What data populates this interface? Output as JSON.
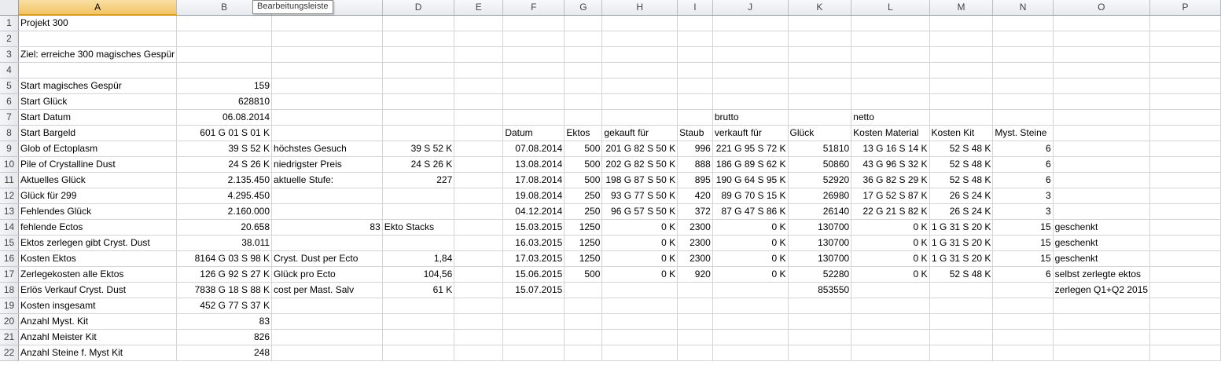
{
  "columns": [
    "A",
    "B",
    "C",
    "D",
    "E",
    "F",
    "G",
    "H",
    "I",
    "J",
    "K",
    "L",
    "M",
    "N",
    "O",
    "P"
  ],
  "tooltip": "Bearbeitungsleiste",
  "rows": [
    {
      "num": "1",
      "cells": {
        "A": "Projekt 300"
      }
    },
    {
      "num": "2",
      "cells": {}
    },
    {
      "num": "3",
      "cells": {
        "A": "Ziel: erreiche 300 magisches Gespür"
      }
    },
    {
      "num": "4",
      "cells": {}
    },
    {
      "num": "5",
      "cells": {
        "A": "Start magisches Gespür",
        "B": "159"
      }
    },
    {
      "num": "6",
      "cells": {
        "A": "Start Glück",
        "B": "628810"
      }
    },
    {
      "num": "7",
      "cells": {
        "A": "Start Datum",
        "B": "06.08.2014",
        "J": "brutto",
        "L": "netto"
      }
    },
    {
      "num": "8",
      "cells": {
        "A": "Start Bargeld",
        "B": "601 G 01 S 01 K",
        "F": "Datum",
        "G": "Ektos",
        "H": "gekauft für",
        "I": "Staub",
        "J": "verkauft für",
        "K": "Glück",
        "L": "Kosten Material",
        "M": "Kosten Kit",
        "N": "Myst. Steine"
      }
    },
    {
      "num": "9",
      "cells": {
        "A": "Glob of Ectoplasm",
        "B": "39 S 52 K",
        "C": "höchstes Gesuch",
        "D": "39 S 52 K",
        "F": "07.08.2014",
        "G": "500",
        "H": "201 G 82 S 50 K",
        "I": "996",
        "J": "221 G 95 S 72 K",
        "K": "51810",
        "L": "13 G 16 S 14 K",
        "M": "52 S 48 K",
        "N": "6"
      }
    },
    {
      "num": "10",
      "cells": {
        "A": "Pile of Crystalline Dust",
        "B": "24 S 26 K",
        "C": "niedrigster Preis",
        "D": "24 S 26 K",
        "F": "13.08.2014",
        "G": "500",
        "H": "202 G 82 S 50 K",
        "I": "888",
        "J": "186 G 89 S 62 K",
        "K": "50860",
        "L": "43 G 96 S 32 K",
        "M": "52 S 48 K",
        "N": "6"
      }
    },
    {
      "num": "11",
      "cells": {
        "A": "Aktuelles Glück",
        "B": "2.135.450",
        "C": "aktuelle Stufe:",
        "D": "227",
        "F": "17.08.2014",
        "G": "500",
        "H": "198 G 87 S 50 K",
        "I": "895",
        "J": "190 G 64 S 95 K",
        "K": "52920",
        "L": "36 G 82 S 29 K",
        "M": "52 S 48 K",
        "N": "6"
      }
    },
    {
      "num": "12",
      "cells": {
        "A": "Glück für 299",
        "B": "4.295.450",
        "F": "19.08.2014",
        "G": "250",
        "H": "93 G 77 S 50 K",
        "I": "420",
        "J": "89 G 70 S 15 K",
        "K": "26980",
        "L": "17 G 52 S 87 K",
        "M": "26 S 24 K",
        "N": "3"
      }
    },
    {
      "num": "13",
      "cells": {
        "A": "Fehlendes Glück",
        "B": "2.160.000",
        "F": "04.12.2014",
        "G": "250",
        "H": "96 G 57 S 50 K",
        "I": "372",
        "J": "87 G 47 S 86 K",
        "K": "26140",
        "L": "22 G 21 S 82 K",
        "M": "26 S 24 K",
        "N": "3"
      }
    },
    {
      "num": "14",
      "cells": {
        "A": "fehlende Ectos",
        "B": "20.658",
        "C": "83",
        "D": "Ekto Stacks",
        "F": "15.03.2015",
        "G": "1250",
        "H": "0 K",
        "I": "2300",
        "J": "0 K",
        "K": "130700",
        "L": "0 K",
        "M": "1 G 31 S 20 K",
        "N": "15",
        "O": "geschenkt"
      }
    },
    {
      "num": "15",
      "cells": {
        "A": "Ektos zerlegen gibt Cryst. Dust",
        "B": "38.011",
        "F": "16.03.2015",
        "G": "1250",
        "H": "0 K",
        "I": "2300",
        "J": "0 K",
        "K": "130700",
        "L": "0 K",
        "M": "1 G 31 S 20 K",
        "N": "15",
        "O": "geschenkt"
      }
    },
    {
      "num": "16",
      "cells": {
        "A": "Kosten Ektos",
        "B": "8164 G 03 S 98 K",
        "C": "Cryst. Dust per Ecto",
        "D": "1,84",
        "F": "17.03.2015",
        "G": "1250",
        "H": "0 K",
        "I": "2300",
        "J": "0 K",
        "K": "130700",
        "L": "0 K",
        "M": "1 G 31 S 20 K",
        "N": "15",
        "O": "geschenkt"
      }
    },
    {
      "num": "17",
      "cells": {
        "A": "Zerlegekosten alle Ektos",
        "B": "126 G 92 S 27 K",
        "C": "Glück pro Ecto",
        "D": "104,56",
        "F": "15.06.2015",
        "G": "500",
        "H": "0 K",
        "I": "920",
        "J": "0 K",
        "K": "52280",
        "L": "0 K",
        "M": "52 S 48 K",
        "N": "6",
        "O": "selbst zerlegte ektos"
      }
    },
    {
      "num": "18",
      "cells": {
        "A": "Erlös Verkauf Cryst. Dust",
        "B": "7838 G 18 S 88 K",
        "C": "cost per Mast. Salv",
        "D": "61 K",
        "F": "15.07.2015",
        "K": "853550",
        "O": "zerlegen Q1+Q2 2015"
      }
    },
    {
      "num": "19",
      "cells": {
        "A": "Kosten insgesamt",
        "B": "452 G 77 S 37 K"
      }
    },
    {
      "num": "20",
      "cells": {
        "A": "Anzahl Myst. Kit",
        "B": "83"
      }
    },
    {
      "num": "21",
      "cells": {
        "A": "Anzahl Meister Kit",
        "B": "826"
      }
    },
    {
      "num": "22",
      "cells": {
        "A": "Anzahl Steine f. Myst Kit",
        "B": "248"
      }
    }
  ]
}
